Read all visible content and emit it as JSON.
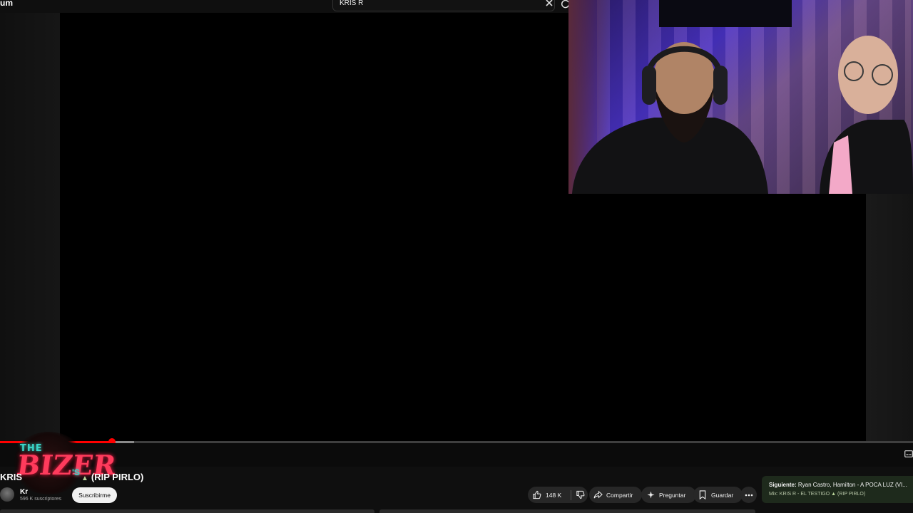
{
  "header": {
    "brand_fragment": "um",
    "search": {
      "value": "KRIS R"
    }
  },
  "icons": {
    "clear": "close-icon",
    "refresh": "refresh-icon",
    "like": "thumbs-up-icon",
    "dislike": "thumbs-down-icon",
    "share": "share-icon",
    "ask": "sparkle-icon",
    "save": "bookmark-icon",
    "more": "more-horizontal-icon",
    "captions": "captions-icon"
  },
  "player": {
    "progress_fraction": 0.123,
    "buffer_fraction": 0.147,
    "accent": "#ff0000"
  },
  "overlay_logo": {
    "text": "THE BIZER'S"
  },
  "video": {
    "title_start": "KRIS",
    "title_end": "(RIP PIRLO)",
    "channel_name": "Kr",
    "subscribers": "596 K suscriptores",
    "subscribe_label": "Suscribirme"
  },
  "actions": {
    "like_count": "148 K",
    "share_label": "Compartir",
    "ask_label": "Preguntar",
    "save_label": "Guardar"
  },
  "up_next": {
    "prefix": "Siguiente:",
    "title": "Ryan Castro, Hamilton - A POCA LUZ (VI...",
    "mix": "Mix: KRIS R - EL TESTIGO",
    "mix_suffix": "(RIP PIRLO)"
  }
}
